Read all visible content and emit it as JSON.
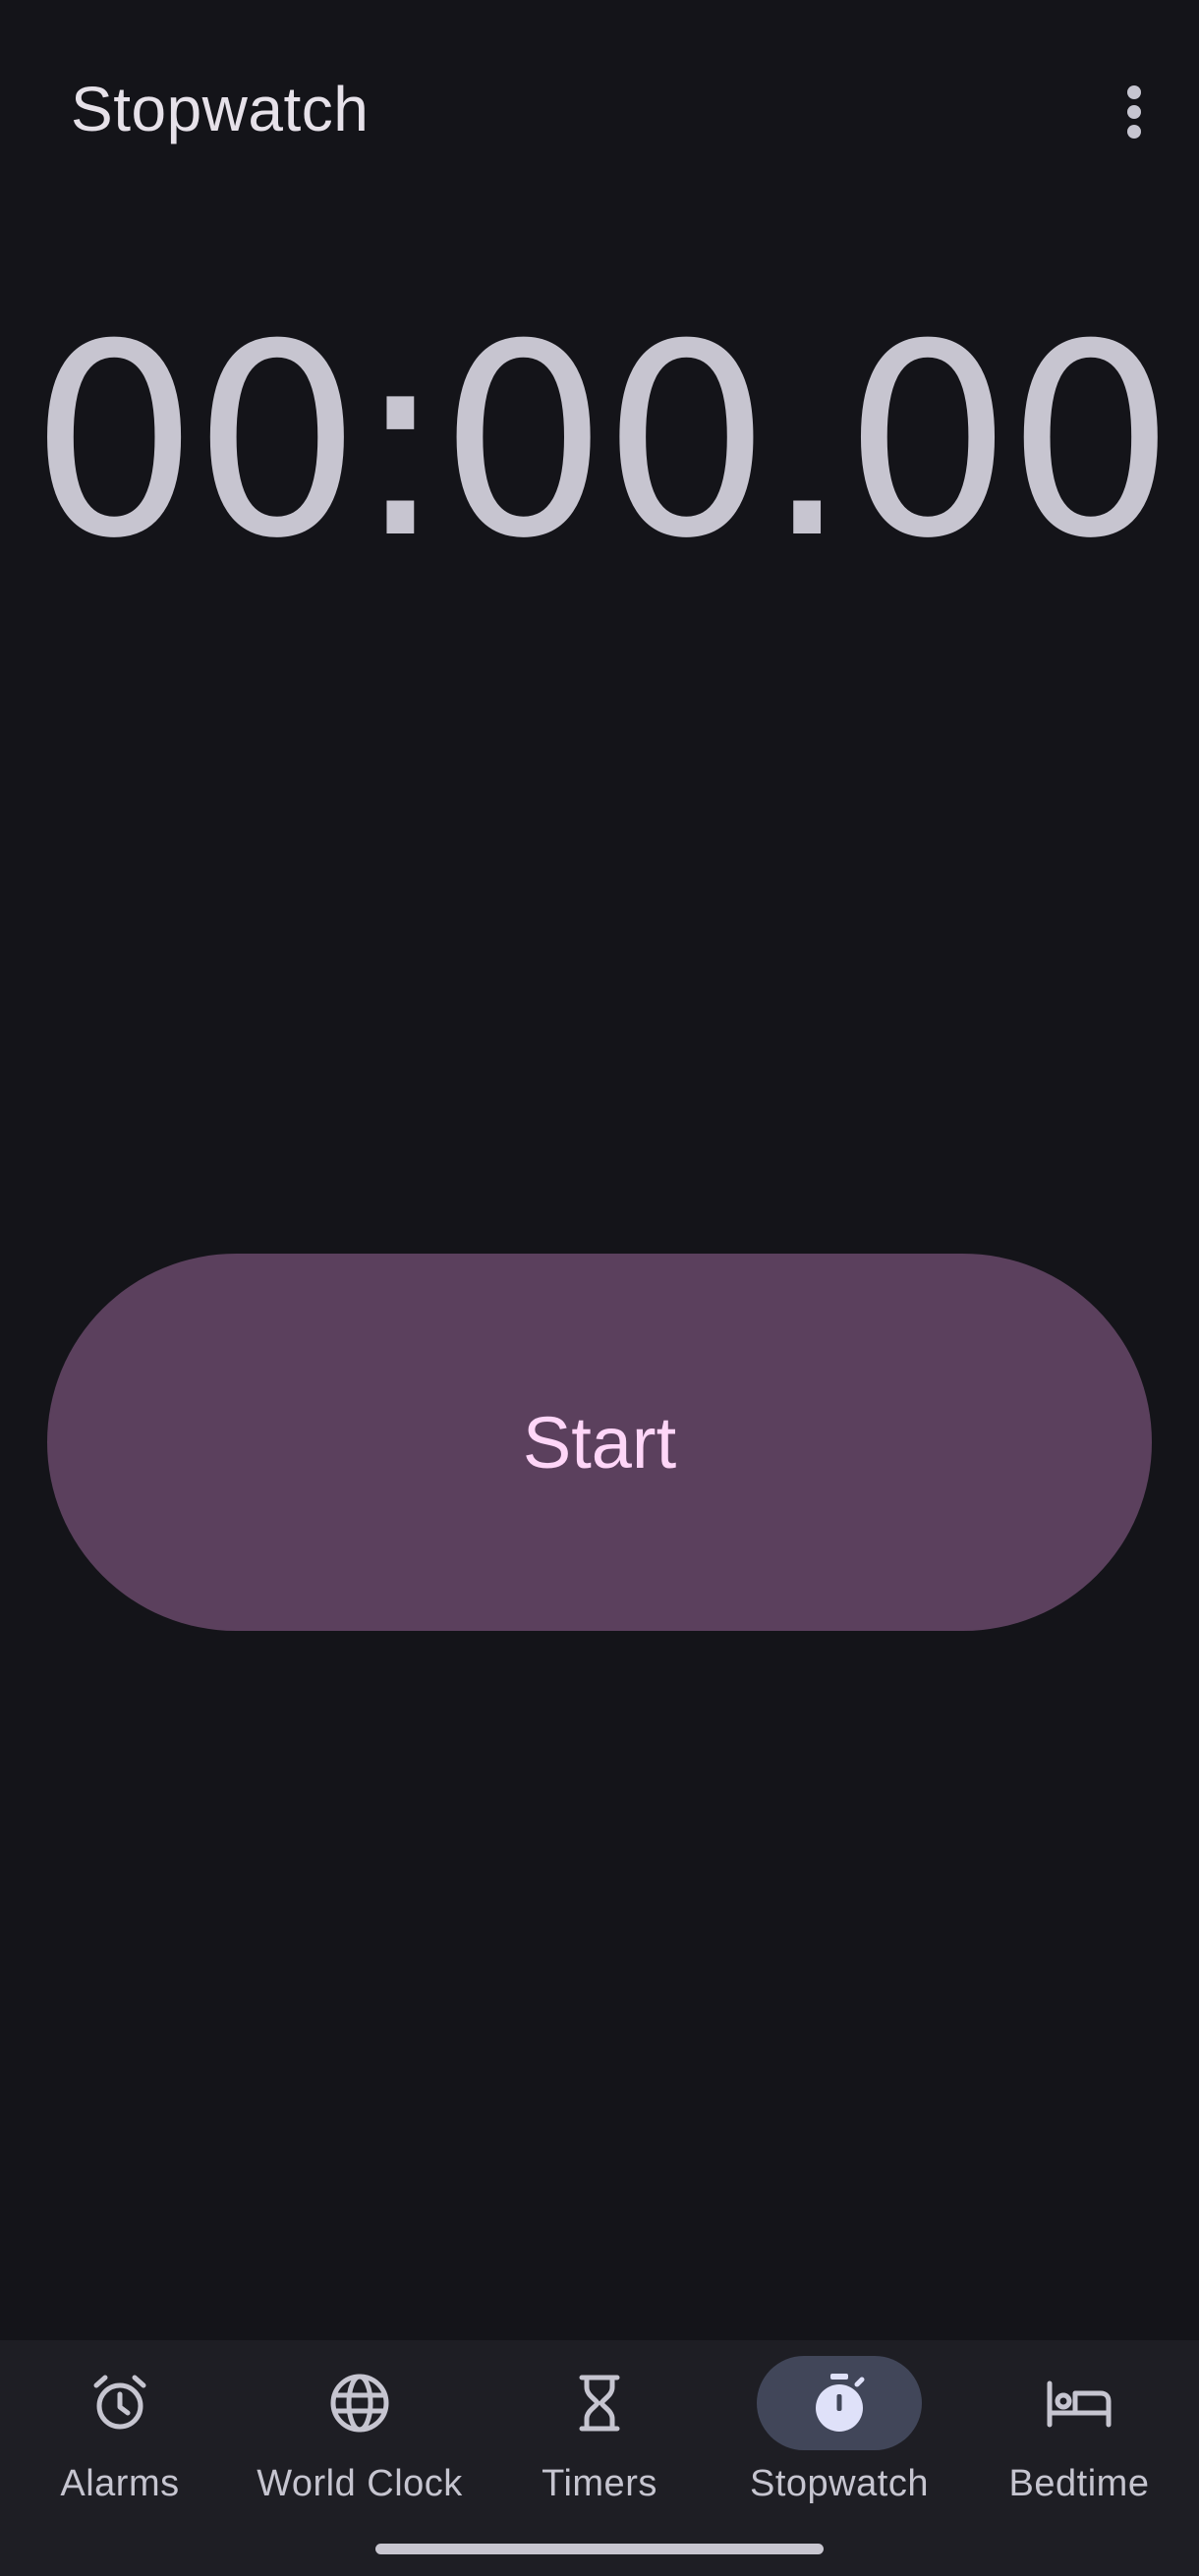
{
  "header": {
    "title": "Stopwatch",
    "more_icon": "more-vert-icon"
  },
  "stopwatch": {
    "time": "00:00.00",
    "start_label": "Start"
  },
  "nav": {
    "items": [
      {
        "label": "Alarms",
        "icon": "alarm-icon",
        "active": false
      },
      {
        "label": "World Clock",
        "icon": "globe-icon",
        "active": false
      },
      {
        "label": "Timers",
        "icon": "hourglass-icon",
        "active": false
      },
      {
        "label": "Stopwatch",
        "icon": "stopwatch-icon",
        "active": true
      },
      {
        "label": "Bedtime",
        "icon": "bed-icon",
        "active": false
      }
    ]
  },
  "colors": {
    "background": "#141419",
    "primary_button": "#5b405d",
    "primary_button_text": "#ffd6f8",
    "nav_background": "#1e1e24",
    "nav_active_pill": "#414659"
  }
}
